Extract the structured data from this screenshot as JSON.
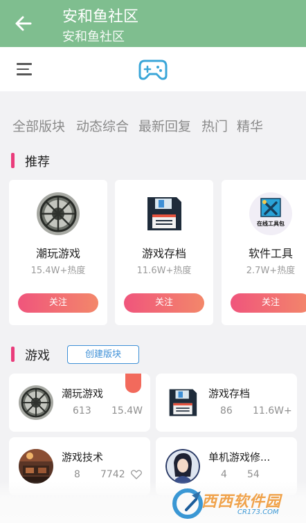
{
  "appbar": {
    "title": "安和鱼社区",
    "subtitle": "安和鱼社区"
  },
  "tabs": [
    "全部版块",
    "动态综合",
    "最新回复",
    "热门",
    "精华"
  ],
  "recommend": {
    "title": "推荐",
    "cards": [
      {
        "name": "潮玩游戏",
        "heat": "15.4W+热度",
        "button": "关注",
        "icon": "wheel-photo-icon"
      },
      {
        "name": "游戏存档",
        "heat": "11.6W+热度",
        "button": "关注",
        "icon": "floppy-disk-icon"
      },
      {
        "name": "软件工具",
        "heat": "2.7W+热度",
        "button": "关注",
        "icon": "toolkit-icon",
        "icon_text": "在线工具包"
      }
    ]
  },
  "games": {
    "title": "游戏",
    "create_button": "创建版块",
    "cards": [
      {
        "name": "潮玩游戏",
        "posts": "613",
        "heat": "15.4W",
        "icon": "wheel-photo-icon"
      },
      {
        "name": "游戏存档",
        "posts": "86",
        "heat": "11.6W+",
        "icon": "floppy-disk-icon"
      },
      {
        "name": "游戏技术",
        "posts": "8",
        "heat": "7742",
        "icon": "interior-photo-icon"
      },
      {
        "name": "单机游戏修...",
        "posts": "4",
        "heat": "54",
        "icon": "anime-portrait-icon"
      }
    ]
  },
  "watermark": {
    "brand": "西西软件园",
    "url": "CR173.COM"
  },
  "colors": {
    "appbar": "#7fbe8f",
    "accent_pink": "#ea3c7b",
    "follow_gradient": [
      "#f0557c",
      "#f3876a"
    ],
    "link_blue": "#3d8fd6",
    "gamepad": "#3aa6d8"
  }
}
